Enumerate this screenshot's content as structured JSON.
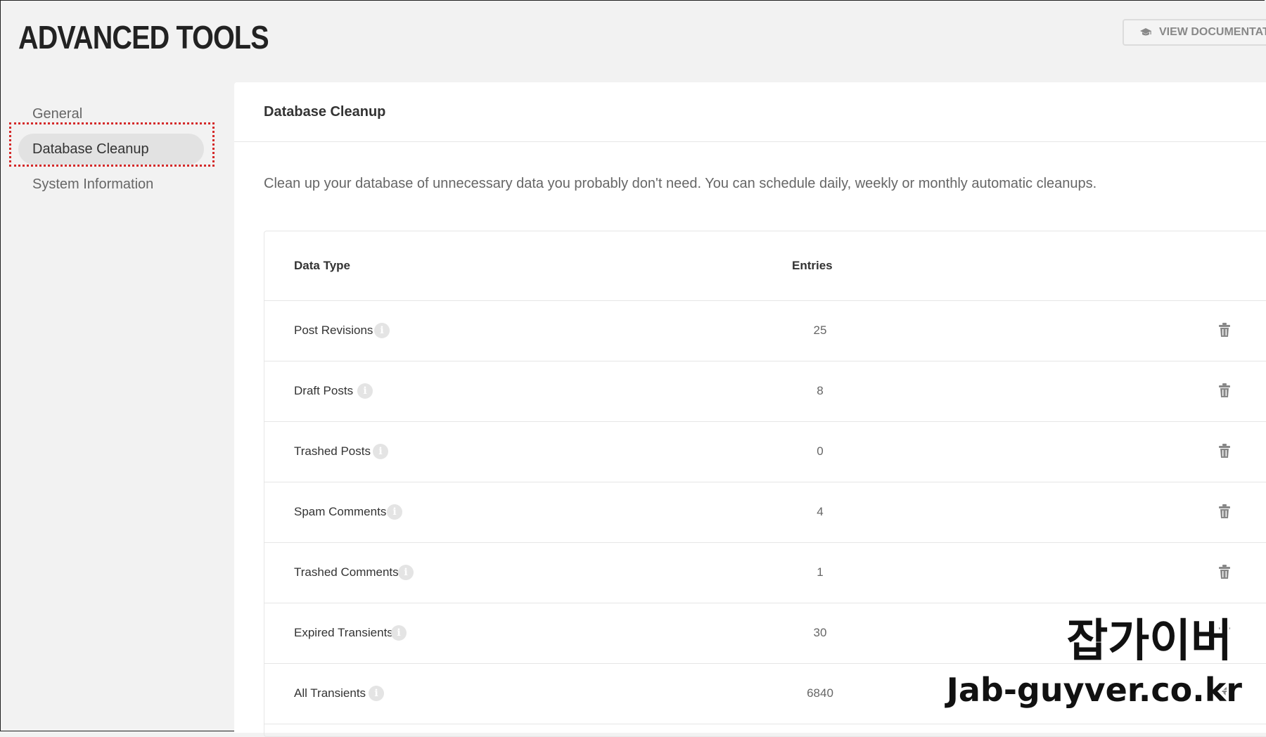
{
  "header": {
    "title": "ADVANCED TOOLS",
    "doc_button": "VIEW DOCUMENTATI"
  },
  "sidebar": {
    "items": [
      {
        "label": "General",
        "active": false
      },
      {
        "label": "Database Cleanup",
        "active": true
      },
      {
        "label": "System Information",
        "active": false
      }
    ]
  },
  "panel": {
    "title": "Database Cleanup",
    "description": "Clean up your database of unnecessary data you probably don't need. You can schedule daily, weekly or monthly automatic cleanups.",
    "columns": [
      "Data Type",
      "Entries"
    ],
    "rows": [
      {
        "name": "Post Revisions",
        "entries": "25",
        "deletable": true
      },
      {
        "name": "Draft Posts",
        "entries": "8",
        "deletable": true
      },
      {
        "name": "Trashed Posts",
        "entries": "0",
        "deletable": true
      },
      {
        "name": "Spam Comments",
        "entries": "4",
        "deletable": true
      },
      {
        "name": "Trashed Comments",
        "entries": "1",
        "deletable": true
      },
      {
        "name": "Expired Transients",
        "entries": "30",
        "deletable": true
      },
      {
        "name": "All Transients",
        "entries": "6840",
        "deletable": true
      }
    ]
  },
  "watermark": {
    "line1": "잡가이버",
    "line2": "Jab-guyver.co.kr"
  },
  "icons": {
    "doc_button_icon": "graduation-cap-icon",
    "info_icon": "info-icon",
    "delete_icon": "trash-icon"
  },
  "colors": {
    "highlight": "#d42a2a",
    "sidebar_active_bg": "#e2e2e2"
  }
}
